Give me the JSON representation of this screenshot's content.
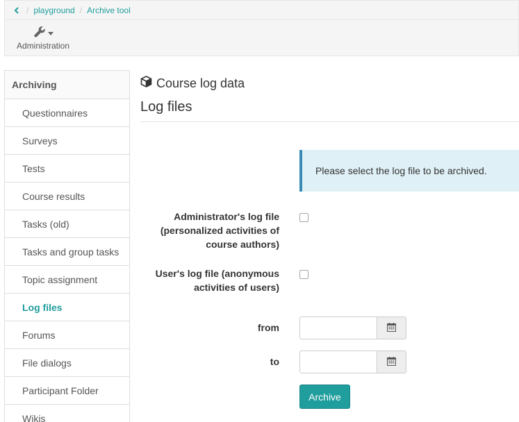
{
  "breadcrumb": {
    "items": [
      "playground",
      "Archive tool"
    ]
  },
  "toolbar": {
    "admin_label": "Administration",
    "admin_icon": "wrench-icon"
  },
  "sidebar": {
    "heading": "Archiving",
    "items": [
      {
        "label": "Questionnaires",
        "active": false
      },
      {
        "label": "Surveys",
        "active": false
      },
      {
        "label": "Tests",
        "active": false
      },
      {
        "label": "Course results",
        "active": false
      },
      {
        "label": "Tasks (old)",
        "active": false
      },
      {
        "label": "Tasks and group tasks",
        "active": false
      },
      {
        "label": "Topic assignment",
        "active": false
      },
      {
        "label": "Log files",
        "active": true
      },
      {
        "label": "Forums",
        "active": false
      },
      {
        "label": "File dialogs",
        "active": false
      },
      {
        "label": "Participant Folder",
        "active": false
      },
      {
        "label": "Wikis",
        "active": false
      }
    ]
  },
  "main": {
    "course_title": "Course log data",
    "page_title": "Log files",
    "info": "Please select the log file to be archived.",
    "form": {
      "admin_log_label_line1": "Administrator's log file",
      "admin_log_label_line2": "(personalized activities of",
      "admin_log_label_line3": "course authors)",
      "admin_log_checked": false,
      "user_log_label_line1": "User's log file (anonymous",
      "user_log_label_line2": "activities of users)",
      "user_log_checked": false,
      "from_label": "from",
      "from_value": "",
      "to_label": "to",
      "to_value": "",
      "archive_button": "Archive"
    }
  },
  "colors": {
    "accent": "#209d9d",
    "info_bg": "#dff0f6",
    "info_border": "#3a8bb4"
  }
}
